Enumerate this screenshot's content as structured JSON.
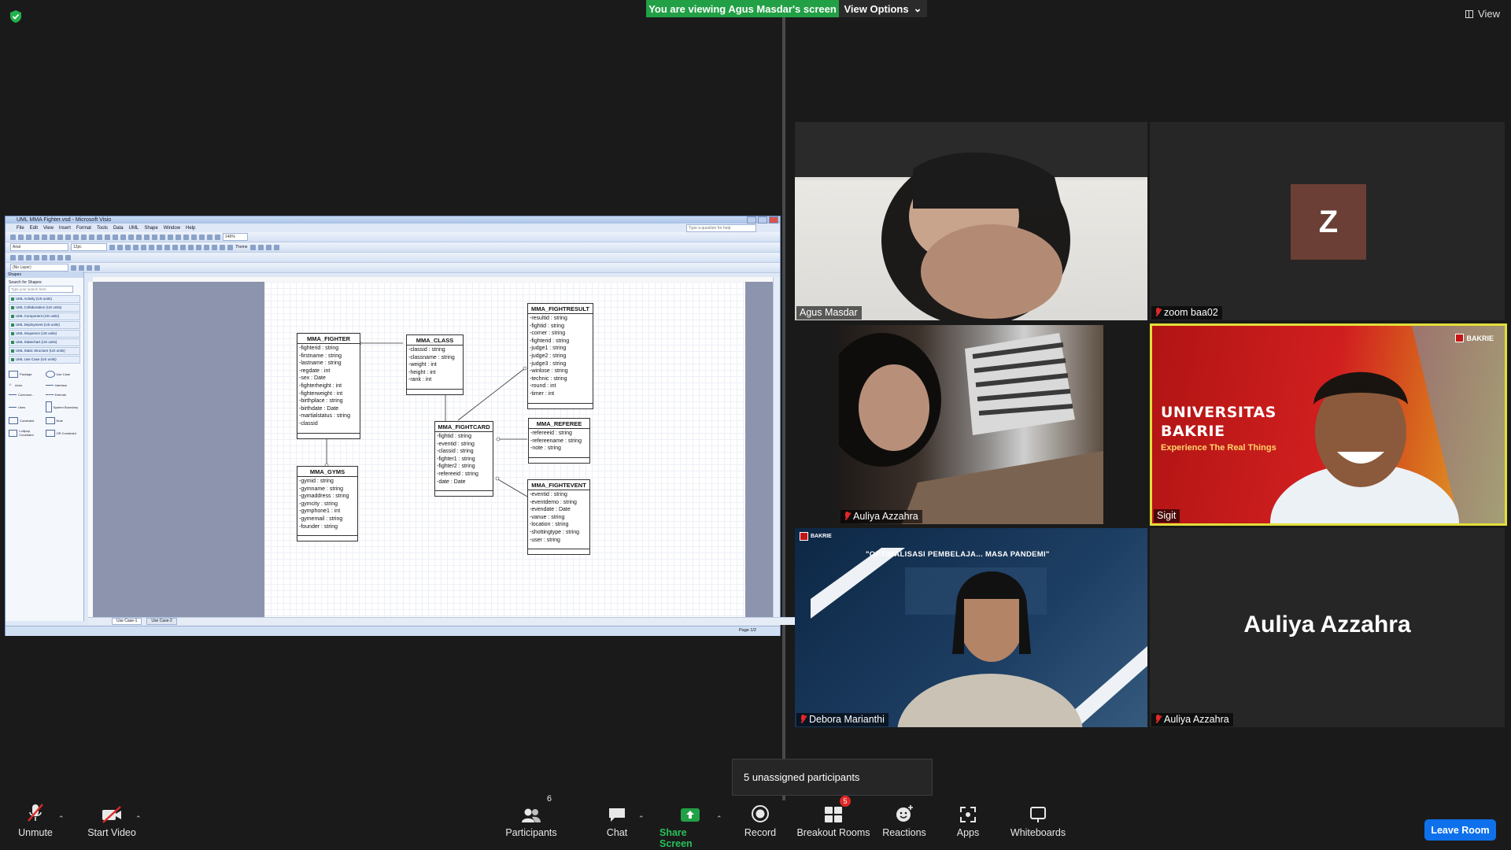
{
  "banner": {
    "viewing_text": "You are viewing Agus Masdar's screen",
    "view_options_label": "View Options",
    "view_label": "View"
  },
  "visio": {
    "title": "UML MMA Fighter.vsd - Microsoft Visio",
    "menu": [
      "File",
      "Edit",
      "View",
      "Insert",
      "Format",
      "Tools",
      "Data",
      "UML",
      "Shape",
      "Window",
      "Help"
    ],
    "ask_placeholder": "Type a question for help",
    "font_name": "Arial",
    "font_size": "12pt.",
    "zoom": "146%",
    "theme_label": "Theme",
    "layer": "(No Layer)",
    "shapes_header": "Shapes",
    "search_label": "Search for Shapes:",
    "search_placeholder": "Type your search here",
    "stencils": [
      "UML Activity (US units)",
      "UML Collaboration (US units)",
      "UML Component (US units)",
      "UML Deployment (US units)",
      "UML Sequence (US units)",
      "UML Statechart (US units)",
      "UML Static Structure (US units)",
      "UML Use Case (US units)"
    ],
    "stencil_shapes": [
      "Package",
      "Use Case",
      "Actor",
      "Interface",
      "Communi...",
      "Extends",
      "Uses",
      "System Boundary",
      "Constraint",
      "Note",
      "Lollipop Constraint",
      "OR Constraint"
    ],
    "page_tabs": [
      "Use Case-1",
      "Use Case-2"
    ],
    "page_status": "Page 1/2"
  },
  "diagram": {
    "entities": [
      {
        "id": "fighter",
        "name": "MMA_FIGHTER",
        "attrs": [
          "-fighterid : string",
          "-firstname : string",
          "-lastname : string",
          "-regdate : int",
          "-sex : Date",
          "-fighterheight : int",
          "-fighterweight : int",
          "-birthplace : string",
          "-birthdate : Date",
          "-martialstatus : string",
          "-classid"
        ]
      },
      {
        "id": "class",
        "name": "MMA_CLASS",
        "attrs": [
          "-classid : string",
          "-classname : string",
          "-weight : int",
          "-height : int",
          "-rank : int"
        ]
      },
      {
        "id": "fightresult",
        "name": "MMA_FIGHTRESULT",
        "attrs": [
          "-resultid : string",
          "-fightid : string",
          "-corner : string",
          "-fighterid : string",
          "-judge1 : string",
          "-judge2 : string",
          "-judge3 : string",
          "-winlose : string",
          "-technic : string",
          "-round : int",
          "-timer : int"
        ]
      },
      {
        "id": "fightcard",
        "name": "MMA_FIGHTCARD",
        "attrs": [
          "-fightid : string",
          "-eventid : string",
          "-classid : string",
          "-fighter1 : string",
          "-fighter2 : string",
          "-refereeid : string",
          "-date : Date"
        ]
      },
      {
        "id": "referee",
        "name": "MMA_REFEREE",
        "attrs": [
          "-refereeid : string",
          "-refereename : string",
          "-note : string"
        ]
      },
      {
        "id": "gyms",
        "name": "MMA_GYMS",
        "attrs": [
          "-gymid : string",
          "-gymname : string",
          "-gymaddress : string",
          "-gymcity : string",
          "-gymphone1 : int",
          "-gymemail : string",
          "-founder : string"
        ]
      },
      {
        "id": "fightevent",
        "name": "MMA_FIGHTEVENT",
        "attrs": [
          "-eventid : string",
          "-eventdemo : string",
          "-evendate : Date",
          "-vanue : string",
          "-location : string",
          "-shottingtype : string",
          "-user : string"
        ]
      }
    ]
  },
  "participants": {
    "tiles": [
      {
        "id": "agus",
        "name": "Agus Masdar",
        "muted": false
      },
      {
        "id": "zoom",
        "name": "zoom baa02",
        "muted": true,
        "avatar_letter": "Z",
        "avatar_color": "#6b3f36"
      },
      {
        "id": "auliya_video",
        "name": "Auliya Azzahra",
        "muted": true
      },
      {
        "id": "sigit",
        "name": "Sigit",
        "muted": false,
        "active_speaker": true
      },
      {
        "id": "debora",
        "name": "Debora Marianthi",
        "muted": true
      },
      {
        "id": "auliya_name",
        "name": "Auliya Azzahra",
        "muted": true,
        "display_name": "Auliya Azzahra"
      }
    ],
    "sigit_background": {
      "title": "UNIVERSITAS\nBAKRIE",
      "tagline": "Experience The Real Things",
      "logo": "BAKRIE"
    },
    "debora_background": {
      "banner": "\"OPTIMALISASI PEMBELAJA... MASA PANDEMI\"",
      "logo": "BAKRIE"
    }
  },
  "notice": {
    "unassigned": "5 unassigned participants"
  },
  "toolbar": {
    "unmute": "Unmute",
    "start_video": "Start Video",
    "participants": "Participants",
    "participants_count": "6",
    "chat": "Chat",
    "share_screen": "Share Screen",
    "record": "Record",
    "breakout_rooms": "Breakout Rooms",
    "breakout_badge": "5",
    "reactions": "Reactions",
    "apps": "Apps",
    "whiteboards": "Whiteboards",
    "leave": "Leave Room"
  },
  "colors": {
    "share_green": "#22a045",
    "leave_blue": "#0e71eb",
    "muted_red": "#e02828",
    "active_speaker_border": "#e2de3a"
  }
}
